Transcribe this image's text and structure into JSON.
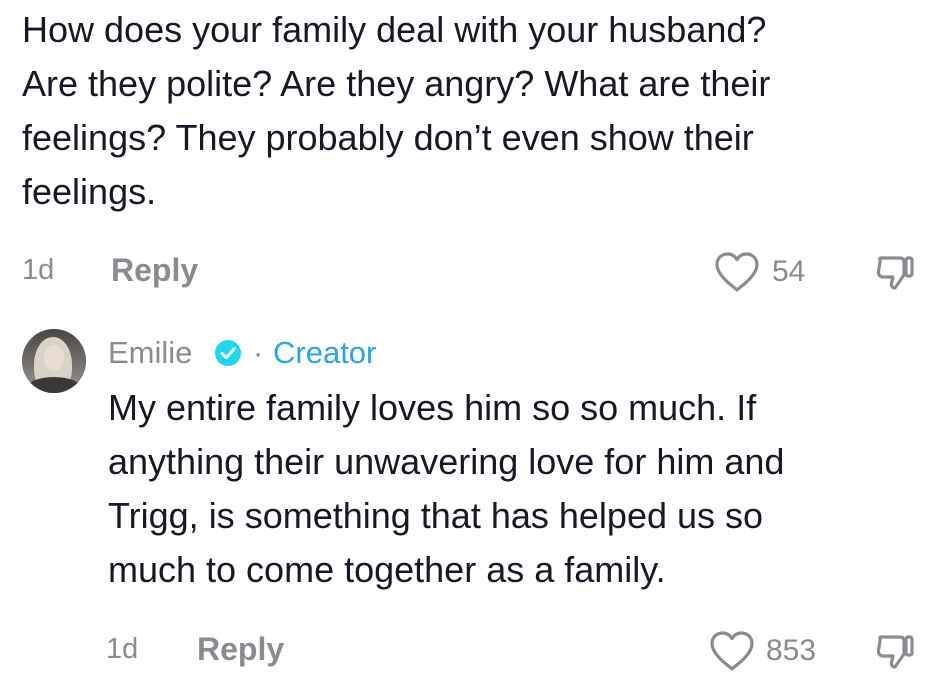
{
  "question": {
    "lines": [
      "How does your family deal with your husband?",
      "Are they polite? Are they angry? What are their",
      "feelings? They probably don’t even show their",
      "feelings."
    ],
    "timestamp": "1d",
    "reply_label": "Reply",
    "like_count": "54"
  },
  "reply": {
    "author": "Emilie",
    "separator": "·",
    "badge": "Creator",
    "lines": [
      "My entire family loves him so so much. If",
      "anything their unwavering love for him and",
      "Trigg, is something that has helped us so",
      "much to come together as a family."
    ],
    "timestamp": "1d",
    "reply_label": "Reply",
    "like_count": "853"
  },
  "icons": {
    "like": "heart-outline-icon",
    "dislike": "thumbs-down-outline-icon",
    "verified": "verified-check-icon"
  },
  "colors": {
    "text": "#161823",
    "muted": "#8a8b91",
    "creator": "#2aa6d8",
    "verified": "#20d5ec"
  }
}
